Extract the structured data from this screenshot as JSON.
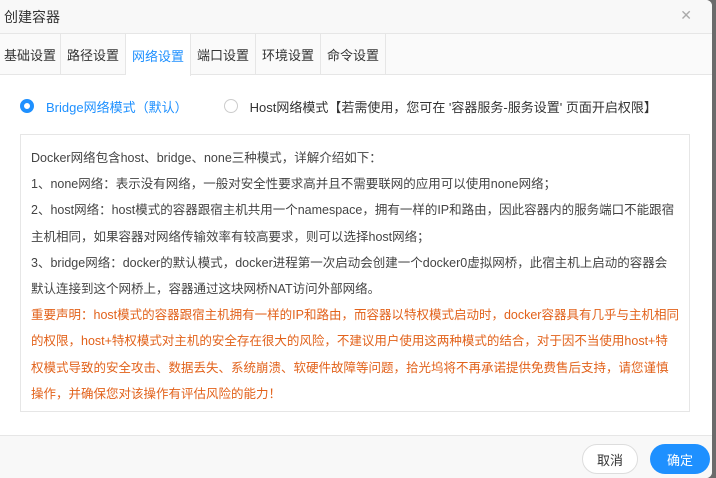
{
  "dialog": {
    "title": "创建容器"
  },
  "tabs": [
    {
      "label": "基础设置"
    },
    {
      "label": "路径设置"
    },
    {
      "label": "网络设置"
    },
    {
      "label": "端口设置"
    },
    {
      "label": "环境设置"
    },
    {
      "label": "命令设置"
    }
  ],
  "network": {
    "bridge_label": "Bridge网络模式（默认）",
    "host_label": "Host网络模式【若需使用，您可在 '容器服务-服务设置' 页面开启权限】",
    "selected": "bridge"
  },
  "info": {
    "intro": "Docker网络包含host、bridge、none三种模式，详解介绍如下：",
    "none": "1、none网络：表示没有网络，一般对安全性要求高并且不需要联网的应用可以使用none网络；",
    "host": "2、host网络：host模式的容器跟宿主机共用一个namespace，拥有一样的IP和路由，因此容器内的服务端口不能跟宿主机相同，如果容器对网络传输效率有较高要求，则可以选择host网络；",
    "bridge": "3、bridge网络：docker的默认模式，docker进程第一次启动会创建一个docker0虚拟网桥，此宿主机上启动的容器会默认连接到这个网桥上，容器通过这块网桥NAT访问外部网络。",
    "warning": "重要声明：host模式的容器跟宿主机拥有一样的IP和路由，而容器以特权模式启动时，docker容器具有几乎与主机相同的权限，host+特权模式对主机的安全存在很大的风险，不建议用户使用这两种模式的结合，对于因不当使用host+特权模式导致的安全攻击、数据丢失、系统崩溃、软硬件故障等问题，拾光坞将不再承诺提供免费售后支持，请您谨慎操作，并确保您对该操作有评估风险的能力！"
  },
  "footer": {
    "cancel": "取消",
    "confirm": "确定"
  }
}
